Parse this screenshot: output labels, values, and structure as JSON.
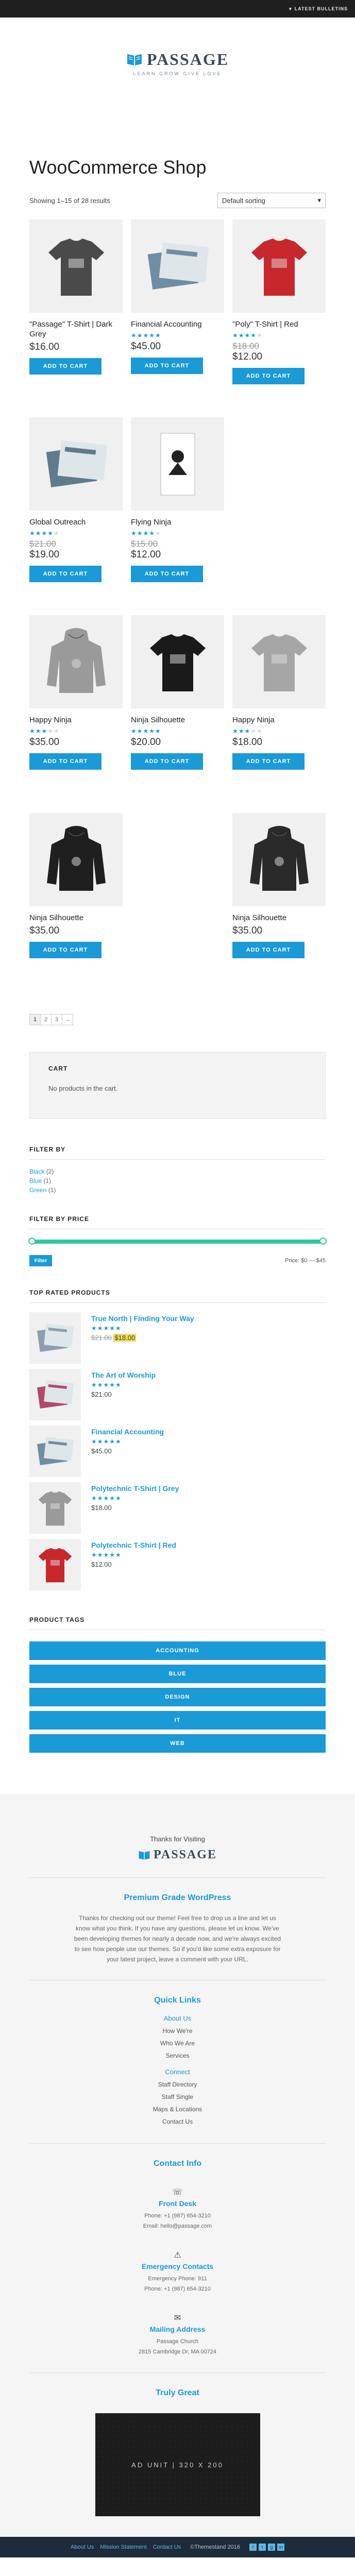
{
  "topbar": {
    "latest_label": "LATEST BULLETINS"
  },
  "brand": {
    "name": "PASSAGE",
    "tagline": "LEARN GROW GIVE LOVE"
  },
  "page": {
    "title": "WooCommerce Shop",
    "result_count": "Showing 1–15 of 28 results",
    "orderby": "Default sorting"
  },
  "products": [
    {
      "name": "\"Passage\" T-Shirt | Dark Grey",
      "price": "$16.00",
      "old_price": "",
      "rating": 0,
      "button": "ADD TO CART",
      "kind": "tee",
      "color": "#4a4a4a"
    },
    {
      "name": "Financial Accounting",
      "price": "$45.00",
      "old_price": "",
      "rating": 5,
      "button": "ADD TO CART",
      "kind": "book",
      "color": "#6f8ea3"
    },
    {
      "name": "\"Poly\" T-Shirt | Red",
      "price": "$12.00",
      "old_price": "$18.00",
      "rating": 4,
      "button": "ADD TO CART",
      "kind": "tee",
      "color": "#c8282c"
    },
    {
      "name": "Global Outreach",
      "price": "$19.00",
      "old_price": "$21.00",
      "rating": 4,
      "button": "ADD TO CART",
      "kind": "book",
      "color": "#5f7b8c"
    },
    {
      "name": "Flying Ninja",
      "price": "$12.00",
      "old_price": "$15.00",
      "rating": 4,
      "button": "ADD TO CART",
      "kind": "poster",
      "color": "#ffffff"
    },
    {
      "name": "",
      "price": "",
      "old_price": "",
      "rating": 0,
      "button": "",
      "kind": "none",
      "color": ""
    },
    {
      "name": "Happy Ninja",
      "price": "$35.00",
      "old_price": "",
      "rating": 3,
      "button": "ADD TO CART",
      "kind": "hoodie",
      "color": "#9a9a9a"
    },
    {
      "name": "Ninja Silhouette",
      "price": "$20.00",
      "old_price": "",
      "rating": 5,
      "button": "ADD TO CART",
      "kind": "tee",
      "color": "#1a1a1a"
    },
    {
      "name": "Happy Ninja",
      "price": "$18.00",
      "old_price": "",
      "rating": 3,
      "button": "ADD TO CART",
      "kind": "tee",
      "color": "#a6a6a6"
    },
    {
      "name": "Ninja Silhouette",
      "price": "$35.00",
      "old_price": "",
      "rating": 0,
      "button": "ADD TO CART",
      "kind": "hoodie",
      "color": "#1f1f1f"
    }
  ],
  "lone_product": {
    "name": "Ninja Silhouette",
    "price": "$35.00",
    "button": "ADD TO CART",
    "kind": "hoodie",
    "color": "#2a2a2a"
  },
  "pagination": [
    "1",
    "2",
    "3",
    "→"
  ],
  "cart": {
    "title": "CART",
    "empty": "No products in the cart."
  },
  "filter_by": {
    "title": "FILTER BY",
    "items": [
      {
        "label": "Black",
        "count": "(2)"
      },
      {
        "label": "Blue",
        "count": "(1)"
      },
      {
        "label": "Green",
        "count": "(1)"
      }
    ]
  },
  "filter_price": {
    "title": "FILTER BY PRICE",
    "button": "Filter",
    "label": "Price: $0 — $45"
  },
  "top_rated": {
    "title": "TOP RATED PRODUCTS",
    "items": [
      {
        "name": "True North | Finding Your Way",
        "old": "$21.00",
        "price": "$18.00",
        "rating": 5,
        "kind": "book",
        "color": "#8a9fb0"
      },
      {
        "name": "The Art of Worship",
        "old": "",
        "price": "$21.00",
        "rating": 5,
        "kind": "book",
        "color": "#b14a6a"
      },
      {
        "name": "Financial Accounting",
        "old": "",
        "price": "$45.00",
        "rating": 5,
        "kind": "book",
        "color": "#6f8ea3"
      },
      {
        "name": "Polytechnic T-Shirt | Grey",
        "old": "",
        "price": "$18.00",
        "rating": 5,
        "kind": "tee",
        "color": "#9a9a9a"
      },
      {
        "name": "Polytechnic T-Shirt | Red",
        "old": "",
        "price": "$12.00",
        "rating": 5,
        "kind": "tee",
        "color": "#c8282c"
      }
    ]
  },
  "tags": {
    "title": "PRODUCT TAGS",
    "items": [
      "ACCOUNTING",
      "BLUE",
      "DESIGN",
      "IT",
      "WEB"
    ]
  },
  "footer": {
    "thanks": "Thanks for Visiting",
    "premium_title": "Premium Grade WordPress",
    "about": "Thanks for checking out our theme! Feel free to drop us a line and let us know what you think. If you have any questions, please let us know. We've been developing themes for nearly a decade now, and we're always excited to see how people use our themes. So if you'd like some extra exposure for your latest project, leave a comment with your URL.",
    "quick_links_title": "Quick Links",
    "about_us": "About Us",
    "about_links": [
      "How We're",
      "Who We Are",
      "Services"
    ],
    "connect": "Connect",
    "connect_links": [
      "Staff Directory",
      "Staff Single",
      "Maps & Locations",
      "Contact Us"
    ],
    "contact_title": "Contact Info",
    "front_desk": "Front Desk",
    "front_phone": "Phone: +1 (987) 654-3210",
    "front_email": "Email: hello@passage.com",
    "emergency": "Emergency Contacts",
    "emergency_1": "Emergency Phone: 911",
    "emergency_2": "Phone: +1 (987) 654-3210",
    "mailing": "Mailing Address",
    "mailing_1": "Passage Church",
    "mailing_2": "2815 Cambridge Dr, MA 00724",
    "truly": "Truly Great",
    "ad_text": "AD UNIT | 320 X 200",
    "bottom_links": [
      "About Us",
      "Mission Statement",
      "Contact Us"
    ],
    "copyright": "©Themestand 2016"
  }
}
